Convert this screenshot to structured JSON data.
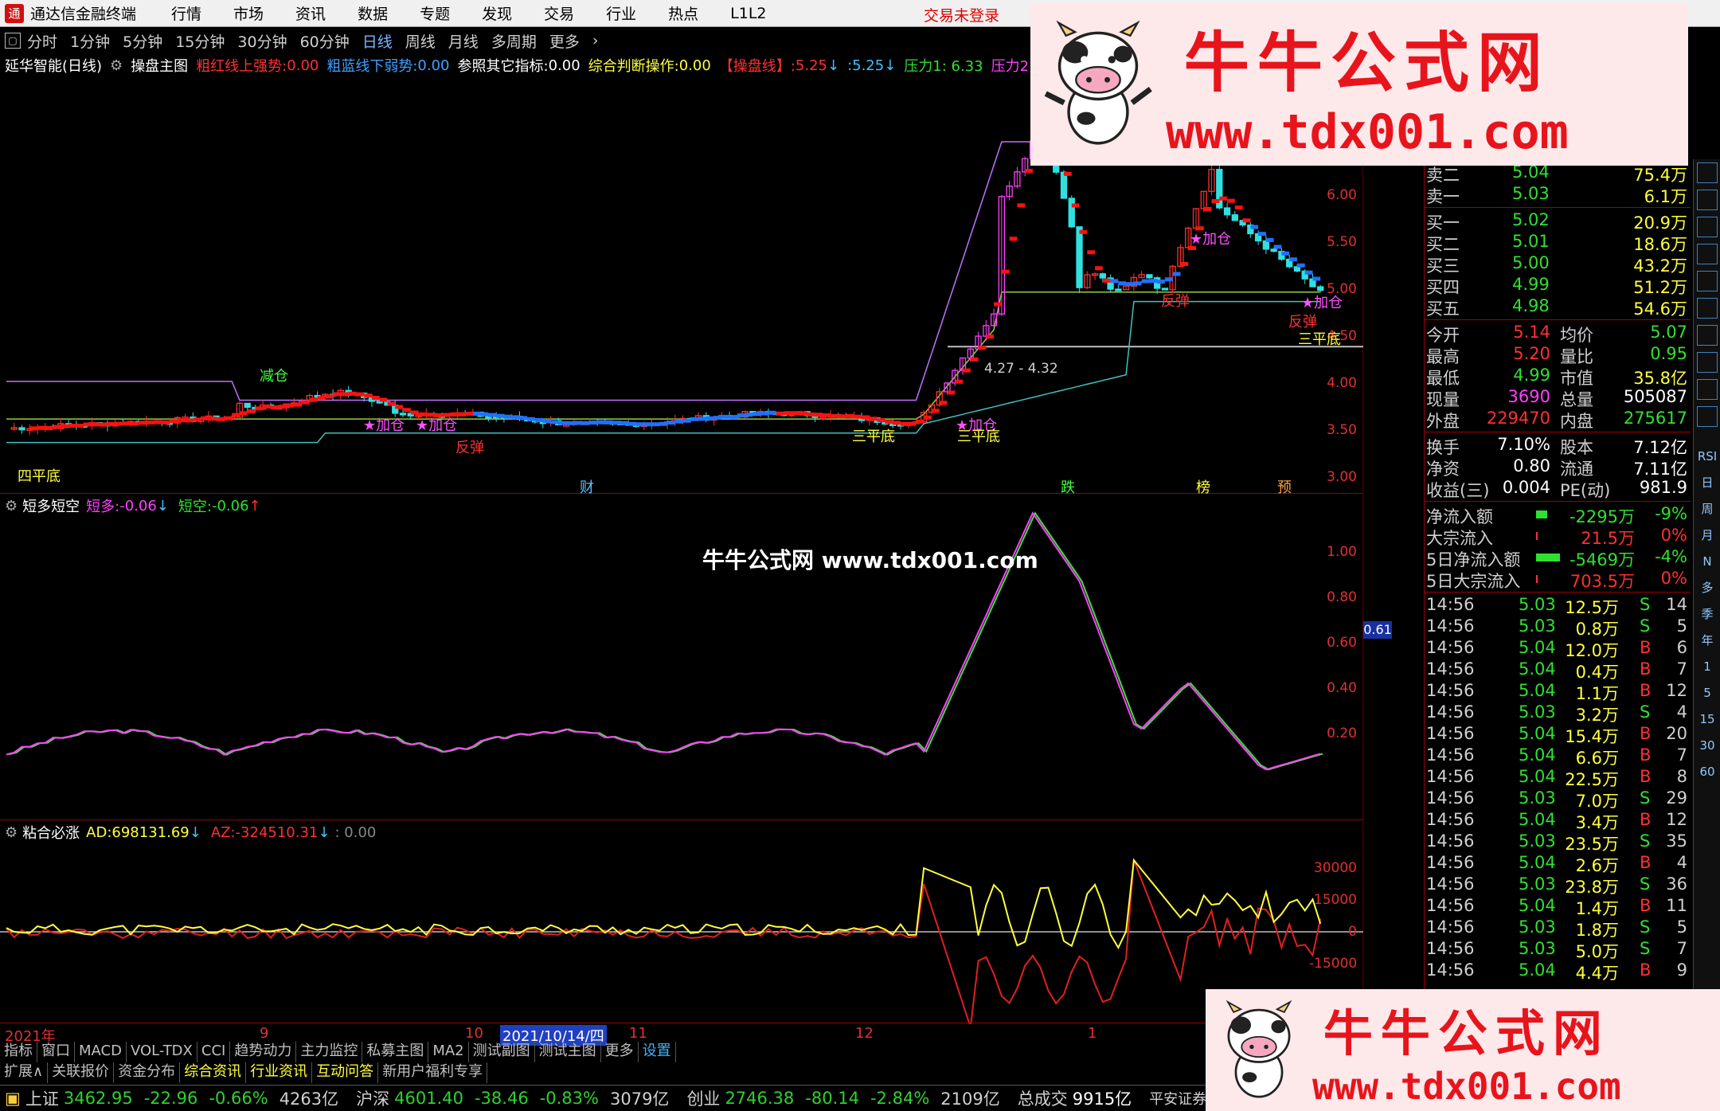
{
  "app": {
    "title": "通达信金融终端",
    "menu": [
      "行情",
      "市场",
      "资讯",
      "数据",
      "专题",
      "发现",
      "交易",
      "行业",
      "热点",
      "L1L2"
    ],
    "login_status": "交易未登录"
  },
  "periods": {
    "items": [
      "分时",
      "1分钟",
      "5分钟",
      "15分钟",
      "30分钟",
      "60分钟",
      "日线",
      "周线",
      "月线",
      "多周期",
      "更多"
    ],
    "active": "日线"
  },
  "main_header": {
    "stock": "延华智能(日线)",
    "indicator": "操盘主图",
    "strong_label": "粗红线上强势:",
    "strong_value": "0.00",
    "weak_label": "粗蓝线下弱势:",
    "weak_value": "0.00",
    "ref_label": "参照其它指标:",
    "ref_value": "0.00",
    "judge_label": "综合判断操作:",
    "judge_value": "0.00",
    "op_label": "【操盘线】:",
    "op_value": "5.25",
    "op_value2": ":5.25",
    "press1": "压力1: 6.33",
    "press2": "压力2: 6"
  },
  "main_pane": {
    "price_labels": [
      "6.00",
      "5.50",
      "5.00",
      "4.50",
      "4.00",
      "3.50",
      "3.00"
    ],
    "price_range": [
      3.0,
      6.5
    ],
    "range_annotation": "4.27 - 4.32",
    "signals": {
      "jiacang": "★加仓",
      "fantan": "反弹",
      "sanpingdi": "三平底",
      "jiancang": "减仓",
      "sipingdi": "四平底"
    },
    "event_markers": [
      "财",
      "跌",
      "榜",
      "预"
    ]
  },
  "sub1": {
    "name": "短多短空",
    "long_label": "短多:",
    "long_value": "-0.06",
    "short_label": "短空:",
    "short_value": "-0.06",
    "axis_labels": [
      "1.00",
      "0.80",
      "0.60",
      "0.40",
      "0.20"
    ],
    "cursor_value": "0.61"
  },
  "sub2": {
    "name": "粘合必涨",
    "ad_label": "AD:",
    "ad_value": "698131.69",
    "az_label": "AZ:",
    "az_value": "-324510.31",
    "extra": ": 0.00",
    "axis_labels": [
      "30000",
      "15000",
      "0",
      "-15000"
    ]
  },
  "date_axis": {
    "labels": [
      "2021年",
      "9",
      "10",
      "11",
      "12",
      "1"
    ],
    "cursor": "2021/10/14/四"
  },
  "tabs_row1": [
    "指标",
    "窗口",
    "MACD",
    "VOL-TDX",
    "CCI",
    "趋势动力",
    "主力监控",
    "私募主图",
    "MA2",
    "测试副图",
    "测试主图",
    "更多",
    "设置"
  ],
  "tabs_row2": [
    "扩展∧",
    "关联报价",
    "资金分布",
    "综合资讯",
    "行业资讯",
    "互动问答",
    "新用户福利专享"
  ],
  "status_bar": {
    "sh_name": "上证",
    "sh_val": "3462.95",
    "sh_chg": "-22.96",
    "sh_pct": "-0.66%",
    "sh_amt": "4263亿",
    "sz_name": "沪深",
    "sz_val": "4601.40",
    "sz_chg": "-38.46",
    "sz_pct": "-0.83%",
    "sz_amt": "3079亿",
    "cy_name": "创业",
    "cy_val": "2746.38",
    "cy_chg": "-80.14",
    "cy_pct": "-2.84%",
    "cy_amt": "2109亿",
    "total_label": "总成交",
    "total_val": "9915亿",
    "broker": "平安证券"
  },
  "quote": {
    "sell": [
      {
        "name": "卖二",
        "price": "5.04",
        "vol": "75.4万"
      },
      {
        "name": "卖一",
        "price": "5.03",
        "vol": "6.1万"
      }
    ],
    "buy": [
      {
        "name": "买一",
        "price": "5.02",
        "vol": "20.9万"
      },
      {
        "name": "买二",
        "price": "5.01",
        "vol": "18.6万"
      },
      {
        "name": "买三",
        "price": "5.00",
        "vol": "43.2万"
      },
      {
        "name": "买四",
        "price": "4.99",
        "vol": "51.2万"
      },
      {
        "name": "买五",
        "price": "4.98",
        "vol": "54.6万"
      }
    ],
    "stats": [
      {
        "l1": "今开",
        "v1": "5.14",
        "l2": "均价",
        "v2": "5.07"
      },
      {
        "l1": "最高",
        "v1": "5.20",
        "l2": "量比",
        "v2": "0.95"
      },
      {
        "l1": "最低",
        "v1": "4.99",
        "l2": "市值",
        "v2": "35.8亿"
      },
      {
        "l1": "现量",
        "v1": "3690",
        "l2": "总量",
        "v2": "505087"
      },
      {
        "l1": "外盘",
        "v1": "229470",
        "l2": "内盘",
        "v2": "275617"
      }
    ],
    "stats2": [
      {
        "l1": "换手",
        "v1": "7.10%",
        "l2": "股本",
        "v2": "7.12亿"
      },
      {
        "l1": "净资",
        "v1": "0.80",
        "l2": "流通",
        "v2": "7.11亿"
      },
      {
        "l1": "收益(三)",
        "v1": "0.004",
        "l2": "PE(动)",
        "v2": "981.9"
      }
    ],
    "flows": [
      {
        "name": "净流入额",
        "val": "-2295万",
        "pct": "-9%"
      },
      {
        "name": "大宗流入",
        "val": "21.5万",
        "pct": "0%"
      },
      {
        "name": "5日净流入额",
        "val": "-5469万",
        "pct": "-4%"
      },
      {
        "name": "5日大宗流入",
        "val": "703.5万",
        "pct": "0%"
      }
    ],
    "ticks": [
      {
        "t": "14:56",
        "p": "5.03",
        "v": "12.5万",
        "bs": "S",
        "n": "14"
      },
      {
        "t": "14:56",
        "p": "5.03",
        "v": "0.8万",
        "bs": "S",
        "n": "5"
      },
      {
        "t": "14:56",
        "p": "5.04",
        "v": "12.0万",
        "bs": "B",
        "n": "6"
      },
      {
        "t": "14:56",
        "p": "5.04",
        "v": "0.4万",
        "bs": "B",
        "n": "7"
      },
      {
        "t": "14:56",
        "p": "5.04",
        "v": "1.1万",
        "bs": "B",
        "n": "12"
      },
      {
        "t": "14:56",
        "p": "5.03",
        "v": "3.2万",
        "bs": "S",
        "n": "4"
      },
      {
        "t": "14:56",
        "p": "5.04",
        "v": "15.4万",
        "bs": "B",
        "n": "20"
      },
      {
        "t": "14:56",
        "p": "5.04",
        "v": "6.6万",
        "bs": "B",
        "n": "7"
      },
      {
        "t": "14:56",
        "p": "5.04",
        "v": "22.5万",
        "bs": "B",
        "n": "8"
      },
      {
        "t": "14:56",
        "p": "5.03",
        "v": "7.0万",
        "bs": "S",
        "n": "29"
      },
      {
        "t": "14:56",
        "p": "5.04",
        "v": "3.4万",
        "bs": "B",
        "n": "12"
      },
      {
        "t": "14:56",
        "p": "5.03",
        "v": "23.5万",
        "bs": "S",
        "n": "35"
      },
      {
        "t": "14:56",
        "p": "5.04",
        "v": "2.6万",
        "bs": "B",
        "n": "4"
      },
      {
        "t": "14:56",
        "p": "5.03",
        "v": "23.8万",
        "bs": "S",
        "n": "36"
      },
      {
        "t": "14:56",
        "p": "5.04",
        "v": "1.4万",
        "bs": "B",
        "n": "11"
      },
      {
        "t": "14:56",
        "p": "5.03",
        "v": "1.8万",
        "bs": "S",
        "n": "5"
      },
      {
        "t": "14:56",
        "p": "5.03",
        "v": "5.0万",
        "bs": "S",
        "n": "7"
      },
      {
        "t": "14:56",
        "p": "5.04",
        "v": "4.4万",
        "bs": "B",
        "n": "9"
      }
    ]
  },
  "side_toolbar": [
    "RSI",
    "日",
    "周",
    "月",
    "N",
    "多",
    "季",
    "年",
    "1",
    "5",
    "15",
    "30",
    "60"
  ],
  "watermark": {
    "title": "牛牛公式网",
    "url": "www.tdx001.com",
    "center": "牛牛公式网 www.tdx001.com"
  },
  "colors": {
    "up": "#ff3030",
    "down": "#30e0e0",
    "ma_red": "#ff1010",
    "ma_blue": "#2070ff",
    "accent_yellow": "#ffff40",
    "watermark_red": "#e8141c"
  }
}
